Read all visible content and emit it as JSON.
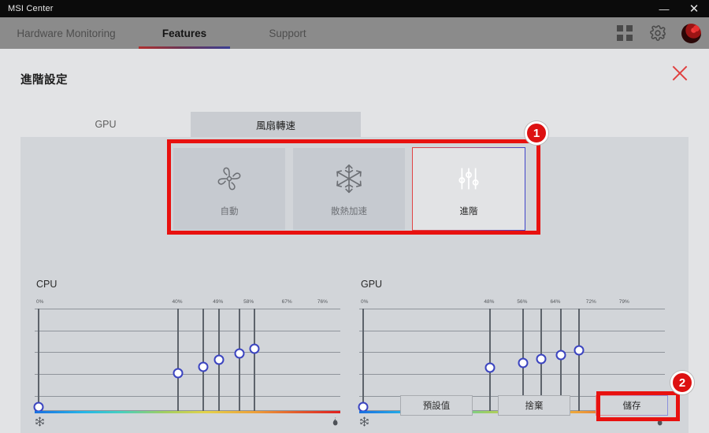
{
  "window": {
    "title": "MSI Center",
    "controls": [
      {
        "name": "minimize",
        "glyph": "—"
      },
      {
        "name": "close",
        "glyph": "✕"
      }
    ]
  },
  "nav": {
    "tabs": [
      {
        "label": "Hardware Monitoring",
        "active": false
      },
      {
        "label": "Features",
        "active": true
      },
      {
        "label": "Support",
        "active": false
      }
    ],
    "icons": [
      {
        "name": "grid-icon"
      },
      {
        "name": "gear-icon"
      },
      {
        "name": "user-avatar"
      }
    ]
  },
  "dialog": {
    "title": "進階設定",
    "close_glyph": "✕",
    "subtabs": [
      {
        "label": "GPU",
        "active": false
      },
      {
        "label": "風扇轉速",
        "active": true
      }
    ],
    "modes": [
      {
        "label": "自動",
        "icon": "fan-icon",
        "selected": false
      },
      {
        "label": "散熱加速",
        "icon": "snowflake-icon",
        "selected": false
      },
      {
        "label": "進階",
        "icon": "sliders-icon",
        "selected": true
      }
    ],
    "buttons": [
      {
        "label": "預設值",
        "name": "default-button",
        "highlighted": false
      },
      {
        "label": "捨棄",
        "name": "discard-button",
        "highlighted": false
      },
      {
        "label": "儲存",
        "name": "save-button",
        "highlighted": true
      }
    ]
  },
  "annotations": [
    {
      "number": "1",
      "target": "mode-selector"
    },
    {
      "number": "2",
      "target": "save-button"
    }
  ],
  "chart_data": [
    {
      "type": "line",
      "title": "CPU",
      "xlabel": "",
      "ylabel": "",
      "grid": true,
      "legend": "none",
      "tick_labels": [
        "0%",
        "40%",
        "49%",
        "58%",
        "67%",
        "76%"
      ],
      "tick_x_pct": [
        3.5,
        56,
        72,
        84,
        99,
        113
      ],
      "points": [
        {
          "label": "0%",
          "x_pct": 3.5,
          "y_pct": 96
        },
        {
          "label": "40%",
          "x_pct": 56,
          "y_pct": 63
        },
        {
          "label": "49%",
          "x_pct": 66,
          "y_pct": 57
        },
        {
          "label": "58%",
          "x_pct": 72,
          "y_pct": 50
        },
        {
          "label": "67%",
          "x_pct": 80,
          "y_pct": 44
        },
        {
          "label": "76%",
          "x_pct": 86,
          "y_pct": 39
        }
      ],
      "gradient_bar": {
        "cold_icon": "snowflake-icon",
        "hot_icon": "flame-icon"
      }
    },
    {
      "type": "line",
      "title": "GPU",
      "xlabel": "",
      "ylabel": "",
      "grid": true,
      "legend": "none",
      "tick_labels": [
        "0%",
        "48%",
        "56%",
        "64%",
        "72%",
        "79%"
      ],
      "tick_x_pct": [
        3.5,
        51,
        64,
        77,
        91,
        104
      ],
      "points": [
        {
          "label": "0%",
          "x_pct": 3.5,
          "y_pct": 96
        },
        {
          "label": "48%",
          "x_pct": 51,
          "y_pct": 58
        },
        {
          "label": "56%",
          "x_pct": 64,
          "y_pct": 53
        },
        {
          "label": "64%",
          "x_pct": 71,
          "y_pct": 49
        },
        {
          "label": "72%",
          "x_pct": 79,
          "y_pct": 45
        },
        {
          "label": "79%",
          "x_pct": 86,
          "y_pct": 41
        }
      ],
      "gradient_bar": {
        "cold_icon": "snowflake-icon",
        "hot_icon": "flame-icon"
      }
    }
  ],
  "colors": {
    "accent_red": "#dd1111",
    "accent_blue": "#3b44c0",
    "titlebar": "#0b0b0b",
    "navbar": "#8b8b8b",
    "dialog_bg": "#e2e3e5",
    "panel_bg": "#d2d5d9"
  }
}
